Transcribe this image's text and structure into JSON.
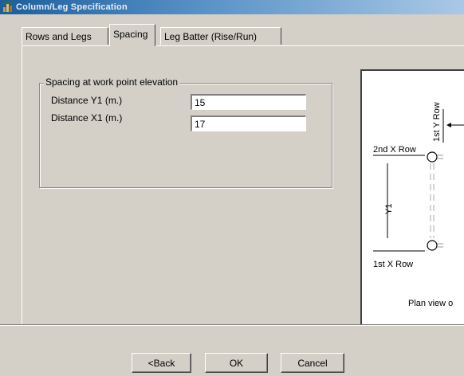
{
  "window": {
    "title": "Column/Leg Specification"
  },
  "tabs": [
    {
      "label": "Rows and Legs"
    },
    {
      "label": "Spacing"
    },
    {
      "label": "Leg Batter (Rise/Run)"
    }
  ],
  "spacing_group": {
    "legend": "Spacing at work point elevation",
    "distance_y1": {
      "label": "Distance Y1 (m.)",
      "value": "15"
    },
    "distance_x1": {
      "label": "Distance X1 (m.)",
      "value": "17"
    }
  },
  "diagram": {
    "first_y_row": "1st Y Row",
    "second_x_row": "2nd X Row",
    "first_x_row": "1st X Row",
    "y1": "Y1",
    "caption": "Plan view o"
  },
  "buttons": {
    "back": "<Back",
    "ok": "OK",
    "cancel": "Cancel"
  },
  "colors": {
    "titlebar_start": "#1b5e9e",
    "dialog_bg": "#d4d0c8"
  }
}
